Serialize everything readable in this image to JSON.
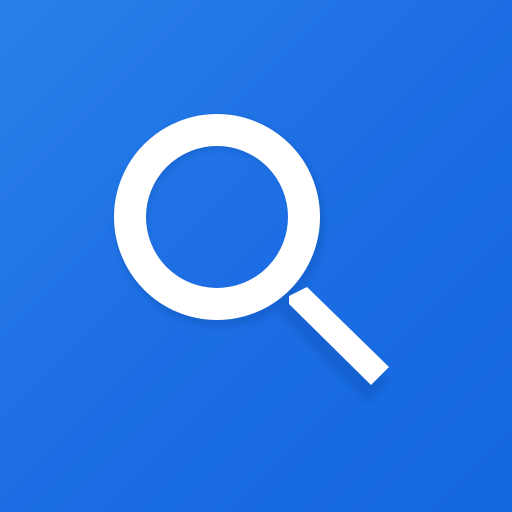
{
  "app_icon": {
    "icon": "search-icon",
    "background_color": "#1A6BE2",
    "glyph_color": "#FFFFFF",
    "shadow_color": "#0E4FB0"
  }
}
